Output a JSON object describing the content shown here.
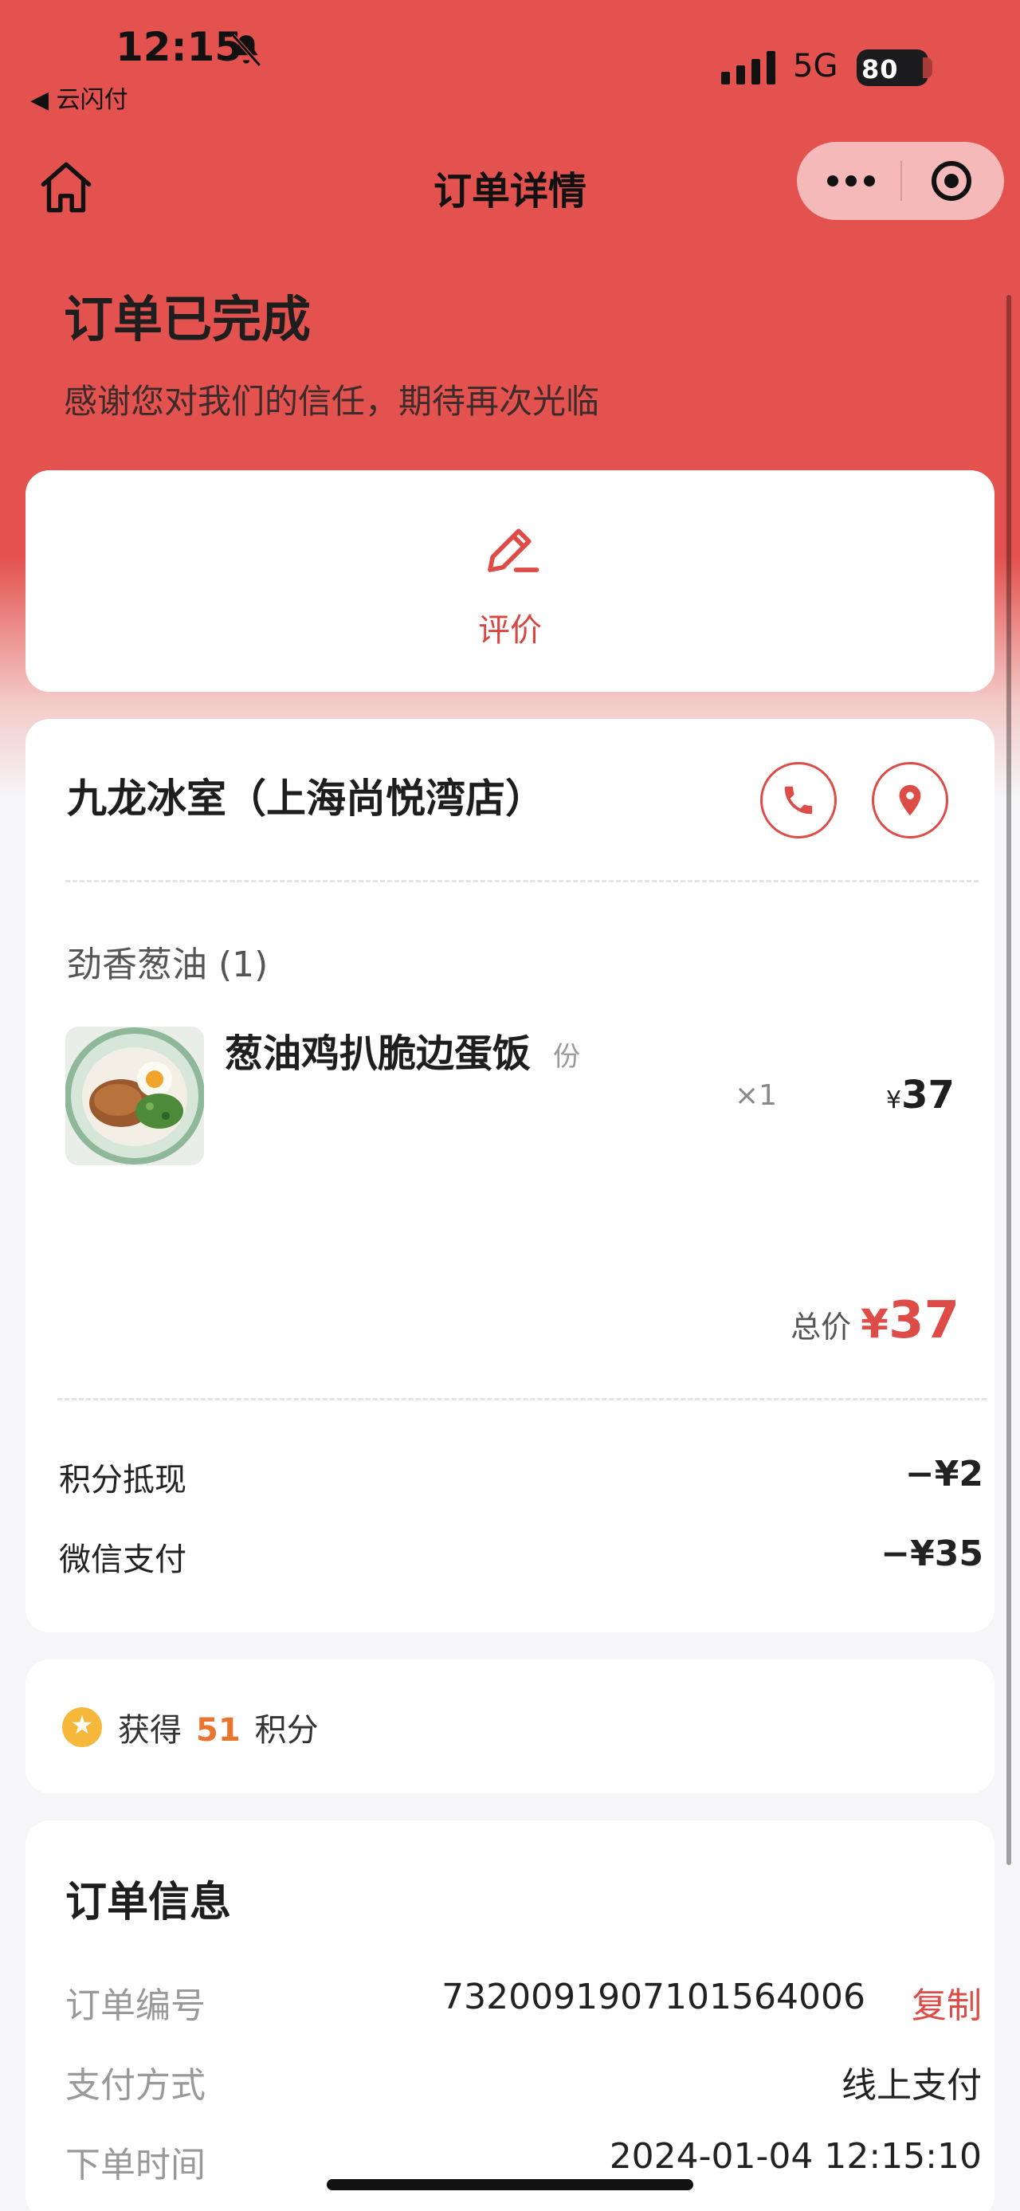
{
  "status_bar": {
    "time": "12:15",
    "back_app": "◀ 云闪付",
    "network": "5G",
    "battery": "80"
  },
  "nav": {
    "title": "订单详情"
  },
  "header": {
    "status": "订单已完成",
    "subtitle": "感谢您对我们的信任，期待再次光临"
  },
  "review": {
    "label": "评价"
  },
  "order": {
    "shop_name": "九龙冰室（上海尚悦湾店）",
    "group_title": "劲香葱油 (1)",
    "dish": {
      "name": "葱油鸡扒脆边蛋饭",
      "unit": "份",
      "qty": "×1",
      "price_symbol": "¥",
      "price": "37"
    },
    "total_label": "总价",
    "total_symbol": "¥",
    "total_value": "37",
    "payments": [
      {
        "label": "积分抵现",
        "amount": "−¥2"
      },
      {
        "label": "微信支付",
        "amount": "−¥35"
      }
    ]
  },
  "points": {
    "prefix": "获得",
    "value": "51",
    "suffix": "积分"
  },
  "info": {
    "title": "订单信息",
    "rows": [
      {
        "label": "订单编号",
        "value": "7320091907101564006",
        "action": "复制"
      },
      {
        "label": "支付方式",
        "value": "线上支付"
      },
      {
        "label": "下单时间",
        "value": "2024-01-04 12:15:10"
      }
    ]
  },
  "colors": {
    "brand_red": "#e3524e",
    "accent_red": "#de4c47",
    "points_orange": "#e9742f",
    "star_yellow": "#f5b83b"
  },
  "icons": [
    "bell-slash-icon",
    "signal-icon",
    "home-icon",
    "more-icon",
    "target-icon",
    "edit-icon",
    "phone-icon",
    "location-pin-icon",
    "star-icon"
  ]
}
